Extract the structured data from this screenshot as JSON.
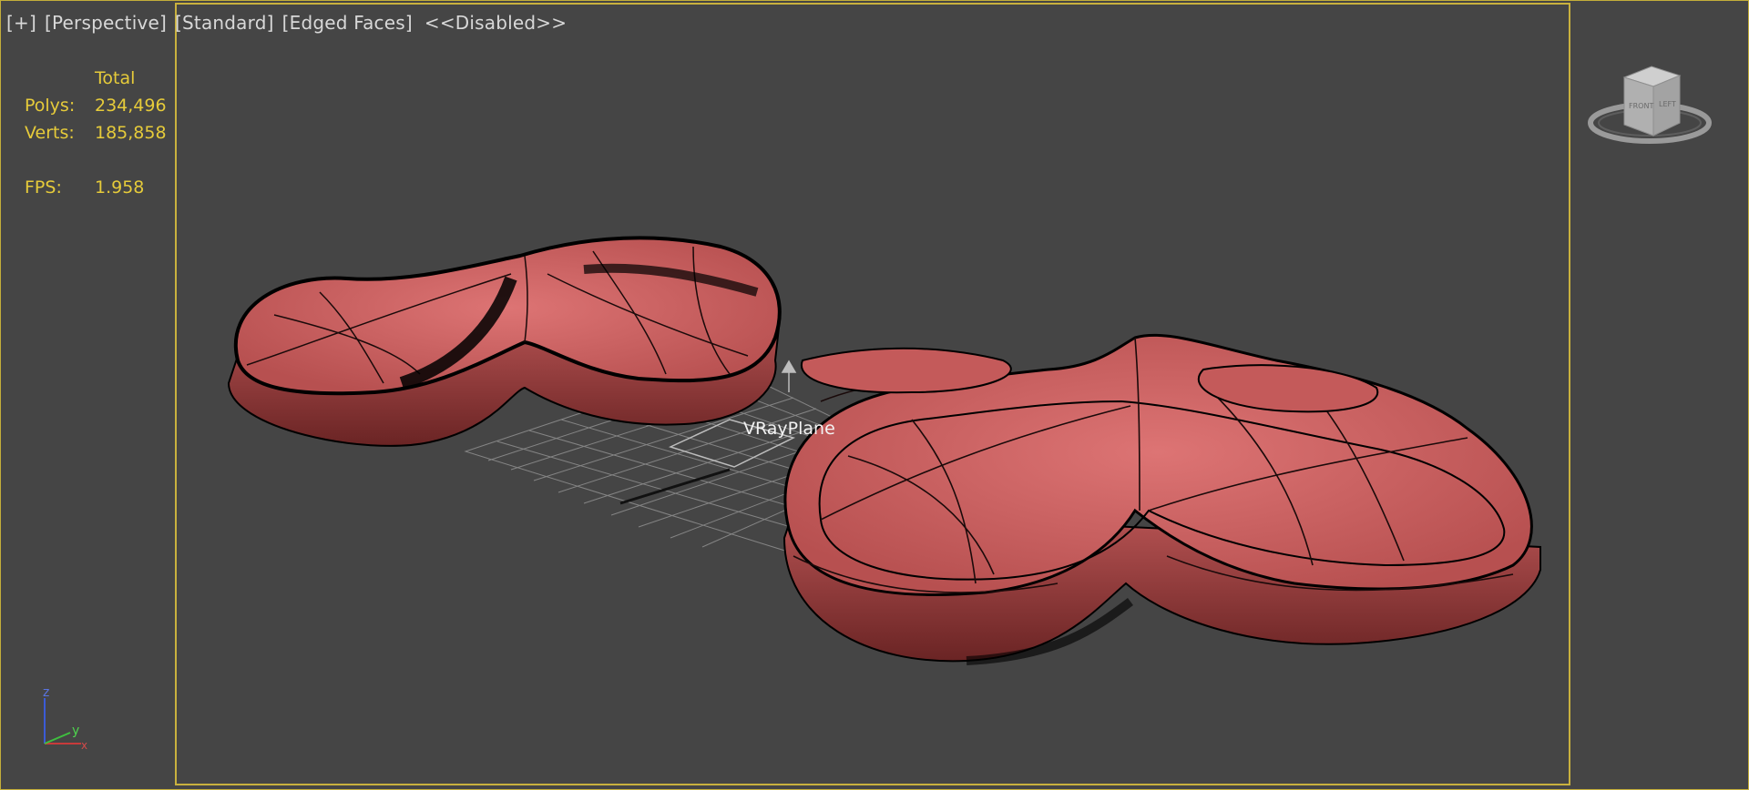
{
  "viewport": {
    "labels": [
      "[+]",
      "[Perspective]",
      "[Standard]",
      "[Edged Faces]",
      "<<Disabled>>"
    ]
  },
  "stats": {
    "header": "Total",
    "rows": [
      {
        "key": "Polys:",
        "value": "234,496"
      },
      {
        "key": "Verts:",
        "value": "185,858"
      },
      {
        "key": "FPS:",
        "value": "1.958"
      }
    ]
  },
  "scene": {
    "object_label": "VRayPlane",
    "object_color": "#cf6262",
    "selection_color": "#c9b13e"
  },
  "viewcube": {
    "faces": [
      "FRONT",
      "LEFT"
    ]
  },
  "axis_tripod": {
    "x": "x",
    "y": "y",
    "z": "z"
  }
}
